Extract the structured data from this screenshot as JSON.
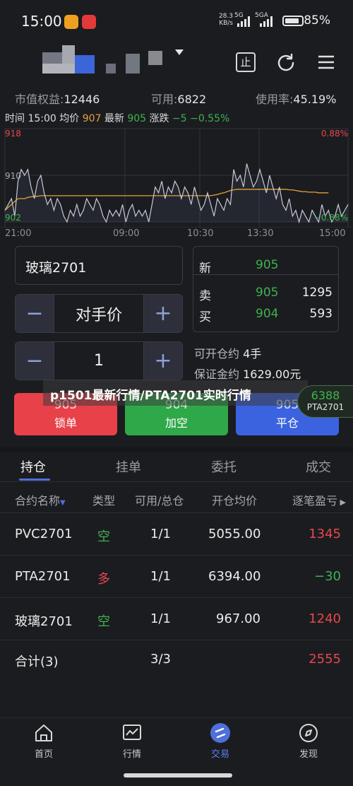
{
  "status_bar": {
    "time": "15:00",
    "net_speed": "28.3",
    "net_unit": "KB/s",
    "net1": "5G",
    "net2": "5GA",
    "battery": "85%",
    "battery_level": 0.85
  },
  "header": {
    "icons": [
      "stop-icon",
      "refresh-icon",
      "menu-icon"
    ],
    "stop_label": "止"
  },
  "account": {
    "equity_label": "市值权益:",
    "equity_value": "12446",
    "available_label": "可用:",
    "available_value": "6822",
    "usage_label": "使用率:",
    "usage_value": "45.19%"
  },
  "quote": {
    "time_label": "时间",
    "time_value": "15:00",
    "avg_label": "均价",
    "avg_value": "907",
    "last_label": "最新",
    "last_value": "905",
    "change_label": "涨跌",
    "change_value": "−5",
    "change_pct": "−0.55%"
  },
  "chart_data": {
    "type": "line",
    "y_left_ticks": [
      "918",
      "910",
      "902"
    ],
    "y_right_ticks": [
      "0.88%",
      "0.00%",
      "−0.88%"
    ],
    "x_ticks": [
      "21:00",
      "09:00",
      "10:30",
      "13:30",
      "15:00"
    ],
    "ylim": [
      902,
      918
    ],
    "colors": {
      "price": "#c8cbd6",
      "average": "#e3a13a"
    },
    "series": [
      {
        "values": [
          904,
          905,
          906,
          903,
          909,
          911,
          910,
          911,
          908,
          906,
          909,
          910,
          907,
          905,
          906,
          904,
          906,
          905,
          903,
          902,
          904,
          903,
          905,
          903,
          904,
          906,
          905,
          904,
          906,
          905,
          903,
          902,
          904,
          903,
          904,
          903,
          905,
          902,
          904,
          905,
          903,
          904,
          903,
          904,
          902,
          905,
          908,
          907,
          909,
          906,
          908,
          907,
          909,
          908,
          906,
          908,
          907,
          905,
          908,
          906,
          904,
          905,
          907,
          905,
          903,
          906,
          905,
          904,
          906,
          905,
          911,
          909,
          910,
          908,
          912,
          910,
          908,
          909,
          911,
          909,
          907,
          910,
          908,
          906,
          908,
          905,
          904,
          906,
          903,
          904,
          902,
          904,
          903,
          902,
          904,
          903,
          902,
          905,
          903,
          904,
          902,
          903,
          905,
          903,
          904,
          905
        ]
      },
      {
        "values": [
          904,
          904.5,
          905,
          905.5,
          906,
          906,
          906,
          906.2,
          906.3,
          906.4,
          906.4,
          906.5,
          906.5,
          906.5,
          906.5,
          906.5,
          906.5,
          906.5,
          906.5,
          906.5,
          906.5,
          906.5,
          906.5,
          906.5,
          906.5,
          906.5,
          906.5,
          906.5,
          906.5,
          906.5,
          906.5,
          906.5,
          906.5,
          906.5,
          906.5,
          906.5,
          906.5,
          906.5,
          906.5,
          906.5,
          906.5,
          906.5,
          906.5,
          906.5,
          906.5,
          906.5,
          906.5,
          906.5,
          906.5,
          906.5,
          906.5,
          906.5,
          906.5,
          906.5,
          906.5,
          906.5,
          906.5,
          906.5,
          906.5,
          906.5,
          906.5,
          906.5,
          906.5,
          906.5,
          906.6,
          906.7,
          906.9,
          907,
          907.2,
          907.4,
          907.5,
          907.6,
          907.6,
          907.6,
          907.6,
          907.6,
          907.6,
          907.6,
          907.6,
          907.6,
          907.6,
          907.6,
          907.6,
          907.6,
          907.6,
          907.6,
          907.6,
          907.5,
          907.5,
          907.4,
          907.3,
          907.2,
          907.2,
          907.1,
          907.1,
          907.1,
          907,
          907,
          907,
          907
        ]
      }
    ]
  },
  "order": {
    "contract": "玻璃2701",
    "price_label": "对手价",
    "qty": "1",
    "minus": "−",
    "plus": "+"
  },
  "book": {
    "last_label": "新",
    "last_price": "905",
    "ask_label": "卖",
    "ask_price": "905",
    "ask_vol": "1295",
    "bid_label": "买",
    "bid_price": "904",
    "bid_vol": "593"
  },
  "info": {
    "openable_label": "可开仓约",
    "openable_value": "4手",
    "margin_label": "保证金约",
    "margin_value": "1629.00元"
  },
  "actions": [
    {
      "price": "905",
      "label": "锁单",
      "color": "#e8414a"
    },
    {
      "price": "904",
      "label": "加空",
      "color": "#2fa84a"
    },
    {
      "price": "905",
      "label": "平仓",
      "color": "#3b63e0"
    }
  ],
  "overlay": {
    "watermark": "p1501最新行情/PTA2701实时行情",
    "float_value": "6388",
    "float_name": "PTA2701"
  },
  "tabs": [
    "持仓",
    "挂单",
    "委托",
    "成交"
  ],
  "table": {
    "headers": [
      "合约名称",
      "类型",
      "可用/总仓",
      "开仓均价",
      "逐笔盈亏"
    ],
    "rows": [
      {
        "name": "PVC2701",
        "type": "空",
        "qty": "1/1",
        "avg": "5055.00",
        "pnl": "1345"
      },
      {
        "name": "PTA2701",
        "type": "多",
        "qty": "1/1",
        "avg": "6394.00",
        "pnl": "−30"
      },
      {
        "name": "玻璃2701",
        "type": "空",
        "qty": "1/1",
        "avg": "967.00",
        "pnl": "1240"
      }
    ],
    "total_label": "合计(3)",
    "total_qty": "3/3",
    "total_pnl": "2555"
  },
  "nav": [
    {
      "label": "首页",
      "icon": "home-icon"
    },
    {
      "label": "行情",
      "icon": "chart-icon"
    },
    {
      "label": "交易",
      "icon": "trade-icon"
    },
    {
      "label": "发现",
      "icon": "compass-icon"
    }
  ]
}
